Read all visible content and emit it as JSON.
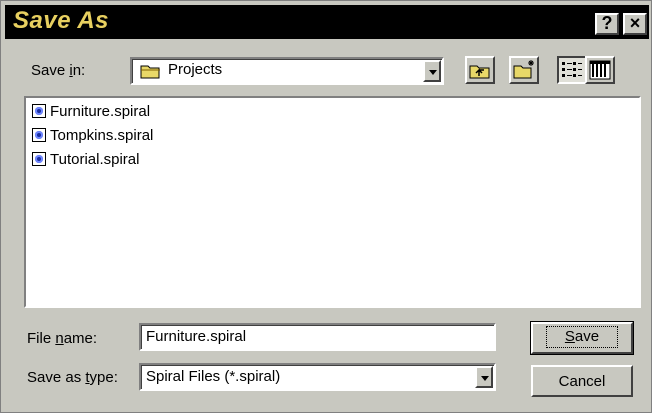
{
  "window": {
    "title": "Save As",
    "help_label": "?",
    "close_label": "×"
  },
  "save_in": {
    "label_pre": "Save ",
    "label_u": "i",
    "label_post": "n:",
    "value": "Projects",
    "icon": "folder-icon"
  },
  "toolbar": {
    "up_icon": "up-one-level-icon",
    "new_folder_icon": "new-folder-icon",
    "list_icon": "list-view-icon",
    "details_icon": "details-view-icon"
  },
  "files": [
    {
      "name": "Furniture.spiral",
      "icon": "spiral-file-icon"
    },
    {
      "name": "Tompkins.spiral",
      "icon": "spiral-file-icon"
    },
    {
      "name": "Tutorial.spiral",
      "icon": "spiral-file-icon"
    }
  ],
  "file_name": {
    "label_pre": "File ",
    "label_u": "n",
    "label_post": "ame:",
    "value": "Furniture.spiral"
  },
  "save_type": {
    "label_pre": "Save as ",
    "label_u": "t",
    "label_post": "ype:",
    "value": "Spiral Files (*.spiral)"
  },
  "buttons": {
    "save_u": "S",
    "save_rest": "ave",
    "cancel": "Cancel"
  }
}
